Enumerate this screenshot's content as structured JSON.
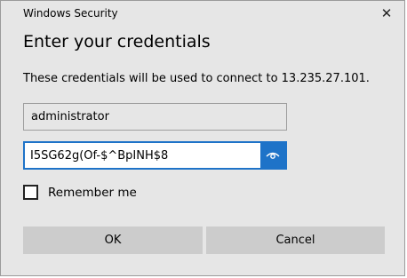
{
  "window": {
    "title": "Windows Security",
    "close_glyph": "✕"
  },
  "dialog": {
    "heading": "Enter your credentials",
    "message": "These credentials will be used to connect to 13.235.27.101.",
    "username": "administrator",
    "password": "I5SG62g(Of-$^BpINH$8",
    "reveal_icon": "eye-icon",
    "remember_label": "Remember me",
    "remember_checked": false
  },
  "buttons": {
    "ok": "OK",
    "cancel": "Cancel"
  },
  "colors": {
    "dialog_bg": "#e6e6e6",
    "accent": "#1e73c8",
    "button_bg": "#cccccc"
  }
}
